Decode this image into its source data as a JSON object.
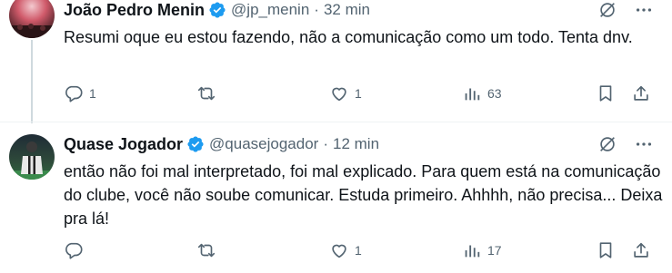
{
  "tweets": [
    {
      "author_name": "João Pedro Menin",
      "handle": "@jp_menin",
      "separator": "·",
      "time": "32 min",
      "text": "Resumi oque eu estou fazendo, não a comunicação como um todo. Tenta dnv.",
      "replies": "1",
      "retweets": "",
      "likes": "1",
      "views": "63"
    },
    {
      "author_name": "Quase Jogador",
      "handle": "@quasejogador",
      "separator": "·",
      "time": "12 min",
      "text": "então não foi mal interpretado, foi mal explicado. Para quem está na comunicação do clube, você não soube comunicar. Estuda primeiro. Ahhhh, não precisa... Deixa pra lá!",
      "replies": "",
      "retweets": "",
      "likes": "1",
      "views": "17"
    }
  ],
  "colors": {
    "text_primary": "#0f1419",
    "text_secondary": "#536471",
    "verified_blue": "#1d9bf0",
    "divider": "#eff3f4"
  },
  "icons": {
    "reply": "reply-icon",
    "retweet": "retweet-icon",
    "like": "like-icon",
    "views": "views-icon",
    "bookmark": "bookmark-icon",
    "share": "share-icon",
    "grok": "grok-icon",
    "more": "more-icon",
    "verified": "verified-badge-icon"
  }
}
